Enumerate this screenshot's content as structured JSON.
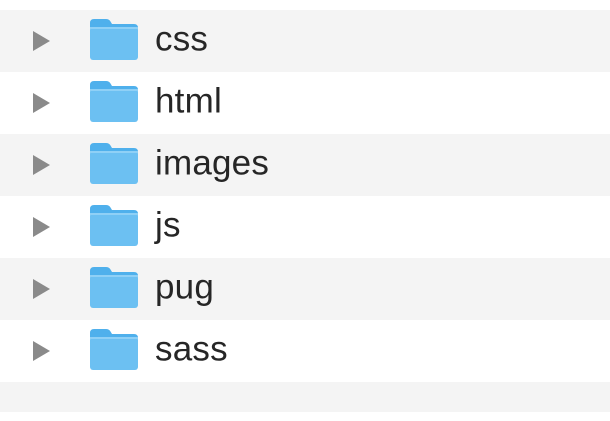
{
  "folders": [
    {
      "name": "css"
    },
    {
      "name": "html"
    },
    {
      "name": "images"
    },
    {
      "name": "js"
    },
    {
      "name": "pug"
    },
    {
      "name": "sass"
    }
  ],
  "icons": {
    "disclosure": "disclosure-triangle-right-icon",
    "folder": "folder-icon"
  },
  "colors": {
    "row_alt": "#f4f4f4",
    "row_plain": "#ffffff",
    "folder_body": "#6cc0f2",
    "folder_tab": "#4fb0ec",
    "disclosure": "#8a8a8a",
    "text": "#262626"
  }
}
